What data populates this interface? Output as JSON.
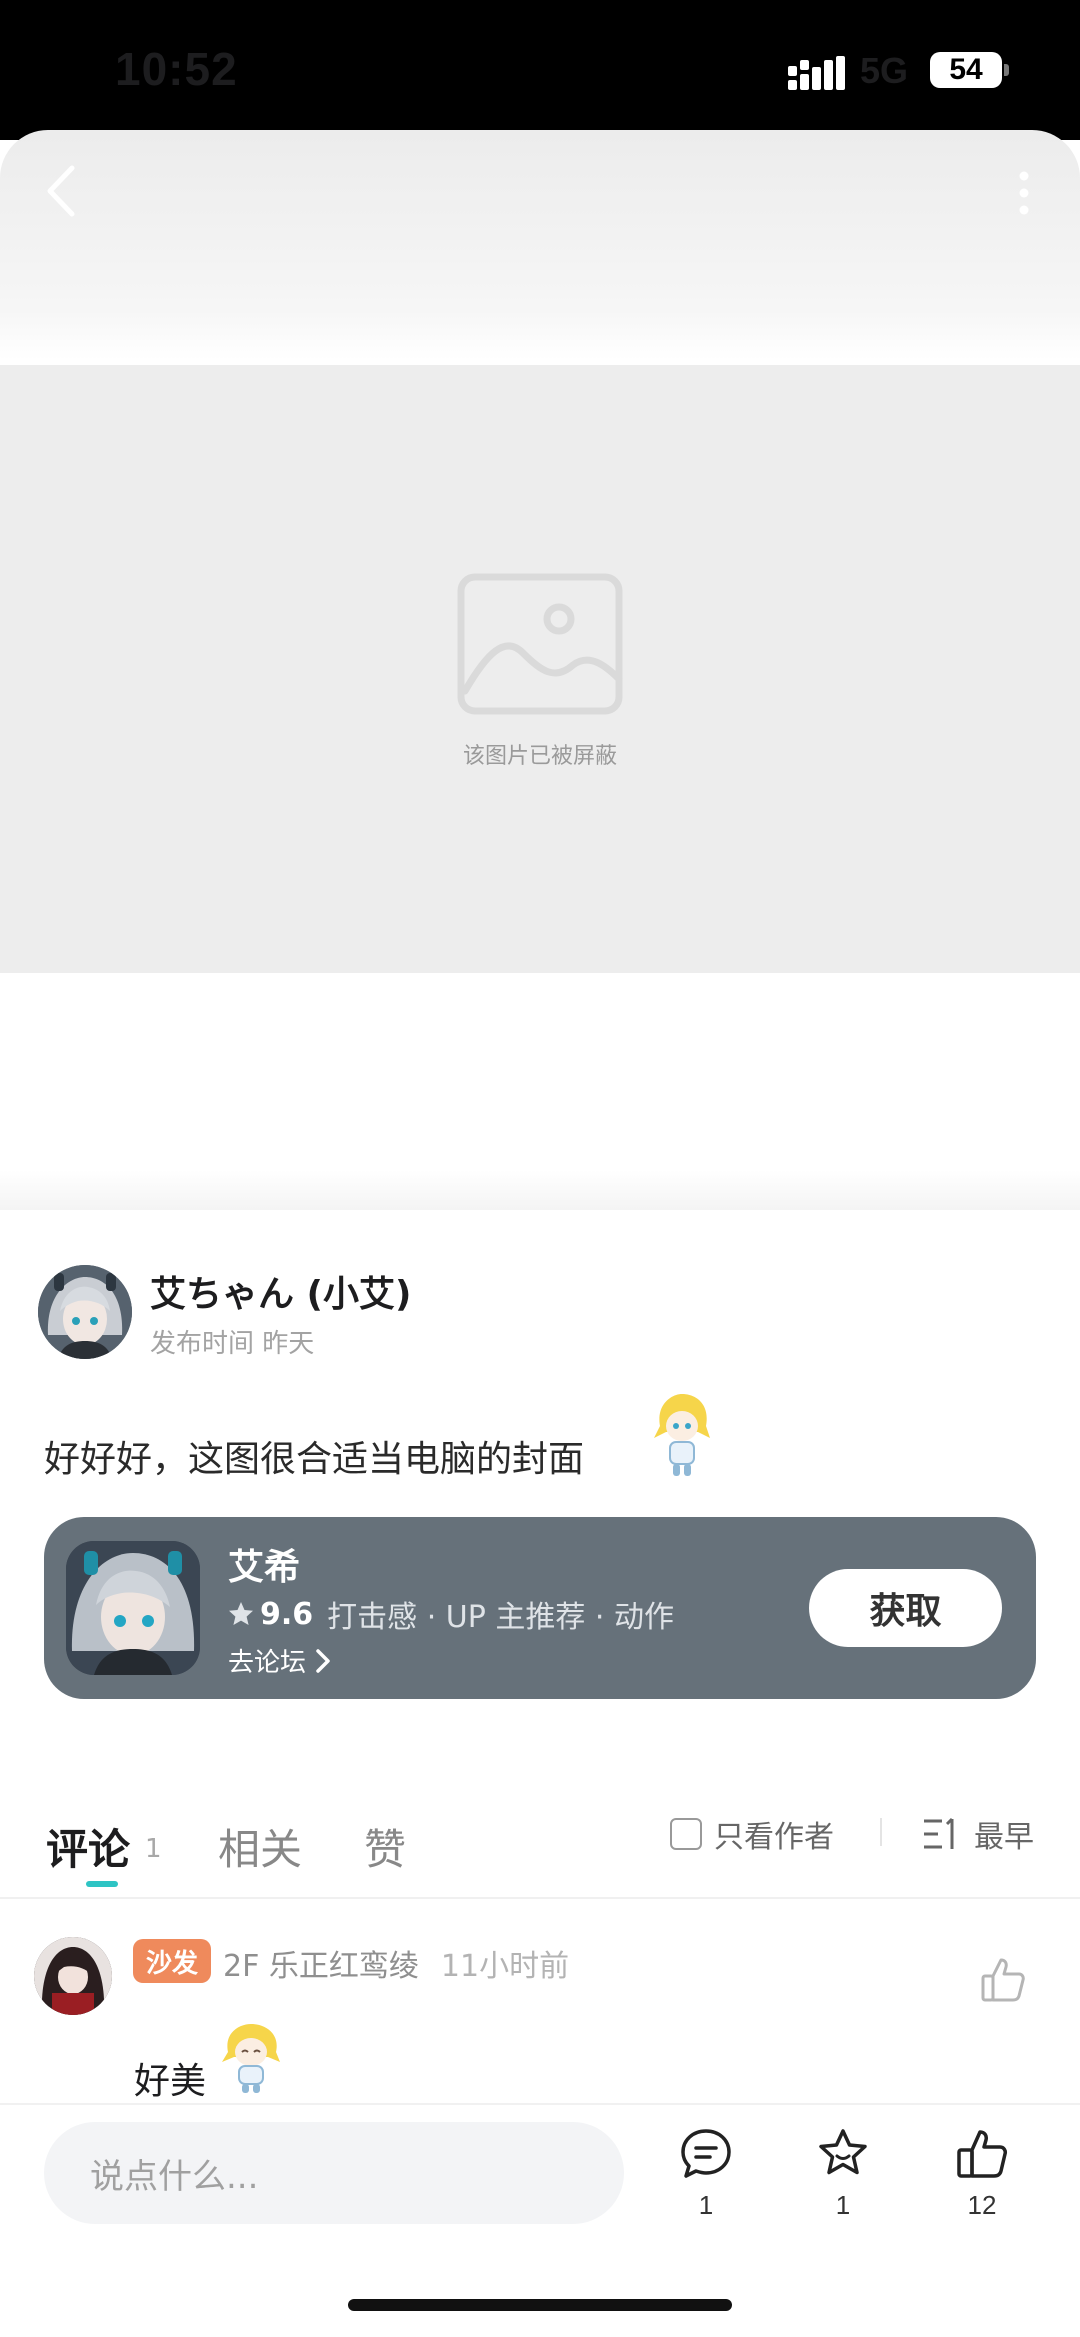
{
  "status_bar": {
    "time": "10:52",
    "network": "5G",
    "battery": "54"
  },
  "hero": {
    "blocked_text": "该图片已被屏蔽"
  },
  "post": {
    "author": "艾ちゃん (小艾)",
    "time": "发布时间 昨天",
    "text": "好好好，这图很合适当电脑的封面"
  },
  "game_card": {
    "name": "艾希",
    "score": "9.6",
    "tags": "打击感 · UP 主推荐 · 动作",
    "forum_link": "去论坛",
    "get_button": "获取"
  },
  "tabs": {
    "comments": "评论",
    "comments_count": "1",
    "related": "相关",
    "likes": "赞",
    "author_only": "只看作者",
    "sort": "最早"
  },
  "comment": {
    "badge": "沙发",
    "meta": "2F 乐正红鸾绫",
    "ago": "11小时前",
    "text": "好美"
  },
  "bottom_bar": {
    "placeholder": "说点什么...",
    "comment_count": "1",
    "fav_count": "1",
    "like_count": "12"
  }
}
